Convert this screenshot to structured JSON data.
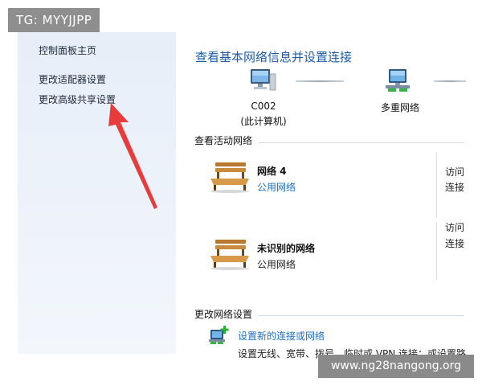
{
  "watermark_tg": "TG: MYYJJPP",
  "watermark_site": "www.ng28nangong.org",
  "sidebar": {
    "links": [
      {
        "label": "控制面板主页"
      },
      {
        "label": "更改适配器设置"
      },
      {
        "label": "更改高级共享设置"
      }
    ]
  },
  "main": {
    "title": "查看基本网络信息并设置连接",
    "network_map": {
      "computer_name": "C002",
      "computer_sub": "(此计算机)",
      "network_name": "多重网络"
    },
    "active_networks": {
      "heading": "查看活动网络",
      "items": [
        {
          "name": "网络 4",
          "type": "公用网络",
          "access_top": "访问",
          "access_bottom": "连接"
        },
        {
          "name": "未识别的网络",
          "type": "公用网络",
          "access_top": "访问",
          "access_bottom": "连接"
        }
      ]
    },
    "change_settings": {
      "heading": "更改网络设置",
      "setup_link": "设置新的连接或网络",
      "setup_desc": "设置无线、宽带、拨号、临时或 VPN 连接；或设置路"
    }
  },
  "colors": {
    "link": "#1f6fc1",
    "title": "#1d5da8",
    "arrow": "#e83b3b",
    "sidebar_bg": "#e9f0f9"
  }
}
